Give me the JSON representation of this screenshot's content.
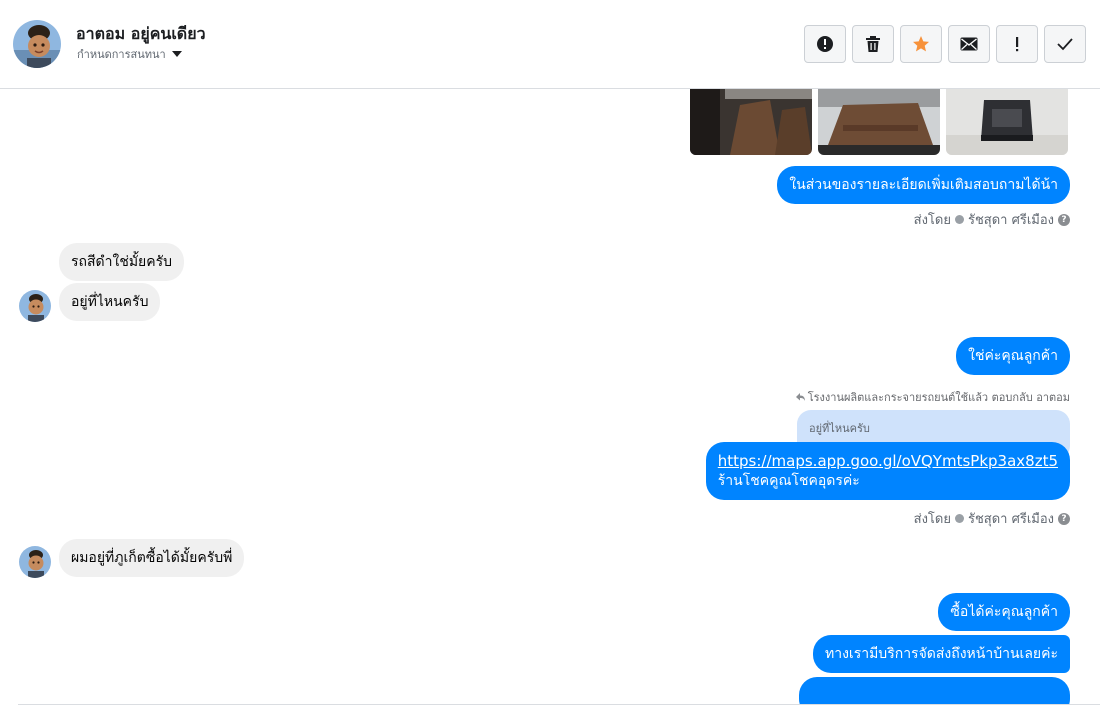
{
  "header": {
    "contact_name": "อาตอม อยู่คนเดียว",
    "conversation_setting": "กำหนดการสนทนา",
    "actions": [
      {
        "icon": "alert-circle-icon",
        "color": "#1c1e21"
      },
      {
        "icon": "trash-icon",
        "color": "#1c1e21"
      },
      {
        "icon": "star-icon",
        "color": "#f7923b"
      },
      {
        "icon": "mail-icon",
        "color": "#1c1e21"
      },
      {
        "icon": "exclamation-icon",
        "color": "#1c1e21"
      },
      {
        "icon": "checkmark-icon",
        "color": "#1c1e21"
      }
    ]
  },
  "messages": {
    "m1": "ในส่วนของรายละเอียดเพิ่มเติมสอบถามได้น้า",
    "sent_by_1": {
      "prefix": "ส่งโดย",
      "name": "รัชสุดา ศรีเมือง"
    },
    "m2": "รถสีดำใช่มั้ยครับ",
    "m3": "อยู่ที่ไหนครับ",
    "m4": "ใช่ค่ะคุณลูกค้า",
    "reply_note": "โรงงานผลิตและกระจายรถยนต์ใช้แล้ว ตอบกลับ อาตอม",
    "quoted": "อยู่ที่ไหนครับ",
    "m5_link": "https://maps.app.goo.gl/oVQYmtsPkp3ax8zt5",
    "m5_text": "ร้านโชคคูณโชคอุดรค่ะ",
    "sent_by_2": {
      "prefix": "ส่งโดย",
      "name": "รัชสุดา ศรีเมือง"
    },
    "m6": "ผมอยู่ที่ภูเก็ตซื้อได้มั้ยครับพี่",
    "m7": "ซื้อได้ค่ะคุณลูกค้า",
    "m8": "ทางเรามีบริการจัดส่งถึงหน้าบ้านเลยค่ะ"
  },
  "colors": {
    "outgoing": "#0084ff",
    "incoming": "#f0f0f0",
    "accent_star": "#f7923b"
  }
}
